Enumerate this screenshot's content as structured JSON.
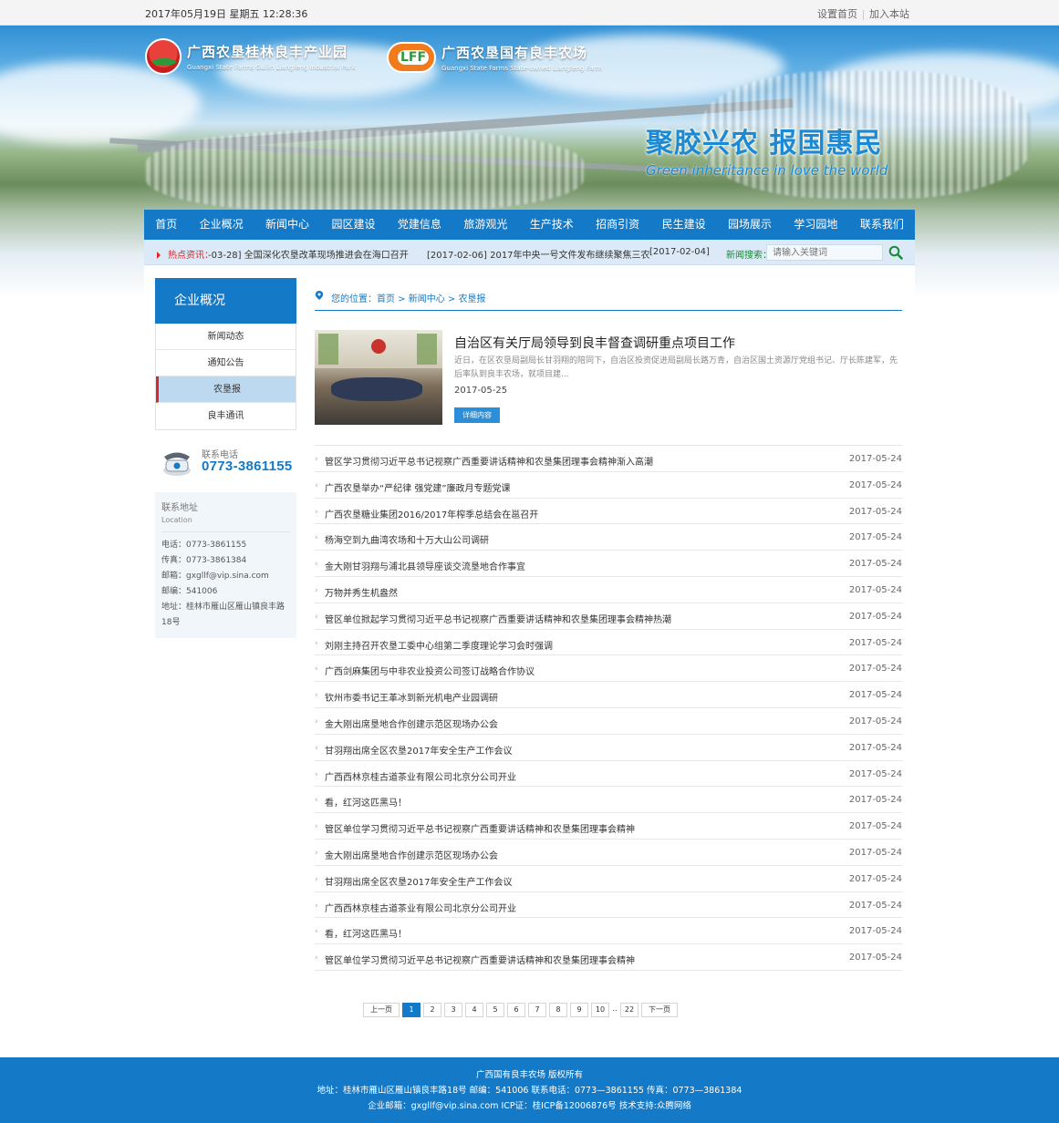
{
  "topbar": {
    "datetime": "2017年05月19日 星期五  12:28:36",
    "set_home": "设置首页",
    "add_favorite": "加入本站"
  },
  "banner": {
    "logo1_cn": "广西农垦桂林良丰产业园",
    "logo1_en": "Guangxi State Farms Guilin Liangfeng Industrial Park",
    "logo2_cn": "广西农垦国有良丰农场",
    "logo2_en": "Guangxi State Farms State-owned Liangfeng Farm",
    "slogan_cn": "聚胶兴农 报国惠民",
    "slogan_en": "Green inheritance in love the world"
  },
  "nav": [
    "首页",
    "企业概况",
    "新闻中心",
    "园区建设",
    "党建信息",
    "旅游观光",
    "生产技术",
    "招商引资",
    "民生建设",
    "园场展示",
    "学习园地",
    "联系我们"
  ],
  "ticker": {
    "label": "热点资讯：",
    "items": [
      "-03-28] 全国深化农垦改革现场推进会在海口召开",
      "[2017-02-06] 2017年中央一号文件发布继续聚焦三农",
      "[2017-02-04]"
    ],
    "search_label": "新闻搜索：",
    "search_placeholder": "请输入关键词"
  },
  "sidebar": {
    "title": "企业概况",
    "items": [
      "新闻动态",
      "通知公告",
      "农垦报",
      "良丰通讯"
    ],
    "phone_label": "联系电话",
    "phone": "0773-3861155",
    "addr_title": "联系地址",
    "addr_sub": "Location",
    "lines": [
      "电话：0773-3861155",
      "传真：0773-3861384",
      "邮箱：gxgllf@vip.sina.com",
      "邮编：541006",
      "地址：桂林市雁山区雁山镇良丰路18号"
    ]
  },
  "breadcrumb": "您的位置：首页 > 新闻中心 > 农垦报",
  "feature": {
    "title": "自治区有关厅局领导到良丰督查调研重点项目工作",
    "summary": "近日，在区农垦局副局长甘羽翔的陪同下，自治区投资促进局副局长路万青，自治区国土资源厅党组书记、厅长陈建军，先后率队到良丰农场，就项目建...",
    "date": "2017-05-25",
    "button": "详细内容"
  },
  "news": [
    {
      "title": "管区学习贯彻习近平总书记视察广西重要讲话精神和农垦集团理事会精神渐入高潮",
      "date": "2017-05-24"
    },
    {
      "title": "广西农垦举办“严纪律 强党建”廉政月专题党课",
      "date": "2017-05-24"
    },
    {
      "title": "广西农垦糖业集团2016/2017年榨季总结会在邕召开",
      "date": "2017-05-24"
    },
    {
      "title": "杨海空到九曲湾农场和十万大山公司调研",
      "date": "2017-05-24"
    },
    {
      "title": "金大刚甘羽翔与浦北县领导座谈交流垦地合作事宜",
      "date": "2017-05-24"
    },
    {
      "title": "万物并秀生机盎然",
      "date": "2017-05-24"
    },
    {
      "title": "管区单位掀起学习贯彻习近平总书记视察广西重要讲话精神和农垦集团理事会精神热潮",
      "date": "2017-05-24"
    },
    {
      "title": "刘刚主持召开农垦工委中心组第二季度理论学习会时强调",
      "date": "2017-05-24"
    },
    {
      "title": "广西剑麻集团与中非农业投资公司签订战略合作协议",
      "date": "2017-05-24"
    },
    {
      "title": "钦州市委书记王革冰到新光机电产业园调研",
      "date": "2017-05-24"
    },
    {
      "title": "金大刚出席垦地合作创建示范区现场办公会",
      "date": "2017-05-24"
    },
    {
      "title": "甘羽翔出席全区农垦2017年安全生产工作会议",
      "date": "2017-05-24"
    },
    {
      "title": "广西西林京桂古道茶业有限公司北京分公司开业",
      "date": "2017-05-24"
    },
    {
      "title": "看，红河这匹黑马！",
      "date": "2017-05-24"
    },
    {
      "title": "管区单位学习贯彻习近平总书记视察广西重要讲话精神和农垦集团理事会精神",
      "date": "2017-05-24"
    },
    {
      "title": "金大刚出席垦地合作创建示范区现场办公会",
      "date": "2017-05-24"
    },
    {
      "title": "甘羽翔出席全区农垦2017年安全生产工作会议",
      "date": "2017-05-24"
    },
    {
      "title": "广西西林京桂古道茶业有限公司北京分公司开业",
      "date": "2017-05-24"
    },
    {
      "title": "看，红河这匹黑马！",
      "date": "2017-05-24"
    },
    {
      "title": "管区单位学习贯彻习近平总书记视察广西重要讲话精神和农垦集团理事会精神",
      "date": "2017-05-24"
    }
  ],
  "pager": {
    "prev": "上一页",
    "pages": [
      "1",
      "2",
      "3",
      "4",
      "5",
      "6",
      "7",
      "8",
      "9",
      "10"
    ],
    "dots": "..",
    "last": "22",
    "next": "下一页",
    "current": "1"
  },
  "footer": {
    "line1": "广西国有良丰农场 版权所有",
    "line2": "地址：桂林市雁山区雁山镇良丰路18号  邮编：541006  联系电话：0773—3861155  传真：0773—3861384",
    "line3": "企业邮箱：gxgllf@vip.sina.com  ICP证：桂ICP备12006876号  技术支持:众腾网络"
  }
}
